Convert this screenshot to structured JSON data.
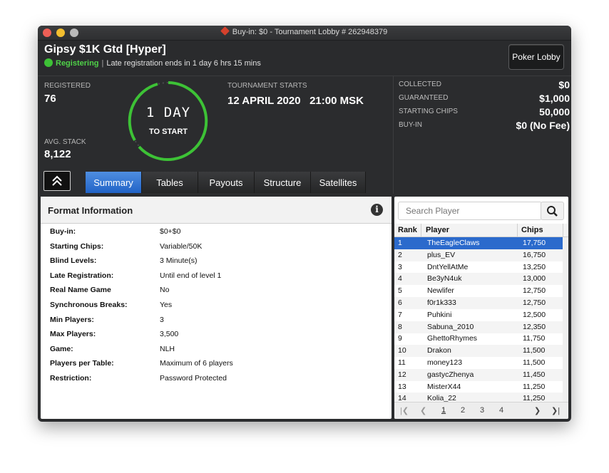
{
  "window": {
    "title": "Buy-in: $0 - Tournament Lobby # 262948379"
  },
  "header": {
    "tournament_name": "Gipsy $1K Gtd [Hyper]",
    "status": "Registering",
    "late_reg_text": "Late registration ends in 1 day 6 hrs 15 mins",
    "poker_lobby_button": "Poker Lobby"
  },
  "stats": {
    "registered_label": "REGISTERED",
    "registered_value": "76",
    "avg_stack_label": "AVG. STACK",
    "avg_stack_value": "8,122",
    "countdown_value": "1 DAY",
    "countdown_sub": "TO START",
    "starts_label": "TOURNAMENT STARTS",
    "starts_value": "12 APRIL 2020   21:00 MSK"
  },
  "prize": {
    "rows": [
      {
        "label": "COLLECTED",
        "value": "$0"
      },
      {
        "label": "GUARANTEED",
        "value": "$1,000"
      },
      {
        "label": "STARTING CHIPS",
        "value": "50,000"
      },
      {
        "label": "BUY-IN",
        "value": "$0 (No Fee)"
      }
    ]
  },
  "tabs": [
    "Summary",
    "Tables",
    "Payouts",
    "Structure",
    "Satellites"
  ],
  "format": {
    "title": "Format Information",
    "rows": [
      {
        "k": "Buy-in:",
        "v": "$0+$0"
      },
      {
        "k": "Starting Chips:",
        "v": "Variable/50K"
      },
      {
        "k": "Blind Levels:",
        "v": "3 Minute(s)"
      },
      {
        "k": "Late Registration:",
        "v": "Until end of level 1"
      },
      {
        "k": "Real Name Game",
        "v": "No"
      },
      {
        "k": "Synchronous Breaks:",
        "v": "Yes"
      },
      {
        "k": "Min Players:",
        "v": "3"
      },
      {
        "k": "Max Players:",
        "v": "3,500"
      },
      {
        "k": "Game:",
        "v": "NLH"
      },
      {
        "k": "Players per Table:",
        "v": "Maximum of 6 players"
      },
      {
        "k": "Restriction:",
        "v": "Password Protected"
      }
    ]
  },
  "players": {
    "search_placeholder": "Search Player",
    "columns": [
      "Rank",
      "Player",
      "Chips"
    ],
    "rows": [
      {
        "rank": "1",
        "name": "TheEagleClaws",
        "chips": "17,750"
      },
      {
        "rank": "2",
        "name": "plus_EV",
        "chips": "16,750"
      },
      {
        "rank": "3",
        "name": "DntYellAtMe",
        "chips": "13,250"
      },
      {
        "rank": "4",
        "name": "Be3yN4uk",
        "chips": "13,000"
      },
      {
        "rank": "5",
        "name": "Newlifer",
        "chips": "12,750"
      },
      {
        "rank": "6",
        "name": "f0r1k333",
        "chips": "12,750"
      },
      {
        "rank": "7",
        "name": "Puhkini",
        "chips": "12,500"
      },
      {
        "rank": "8",
        "name": "Sabuna_2010",
        "chips": "12,350"
      },
      {
        "rank": "9",
        "name": "GhettoRhymes",
        "chips": "11,750"
      },
      {
        "rank": "10",
        "name": "Drakon",
        "chips": "11,500"
      },
      {
        "rank": "11",
        "name": "money123",
        "chips": "11,500"
      },
      {
        "rank": "12",
        "name": "gastycZhenya",
        "chips": "11,450"
      },
      {
        "rank": "13",
        "name": "MisterX44",
        "chips": "11,250"
      },
      {
        "rank": "14",
        "name": "Kolia_22",
        "chips": "11,250"
      }
    ],
    "pages": [
      "1",
      "2",
      "3",
      "4"
    ]
  },
  "colors": {
    "accent": "#2b6acc",
    "status_green": "#3dc236",
    "ring_green": "#3dc236"
  }
}
